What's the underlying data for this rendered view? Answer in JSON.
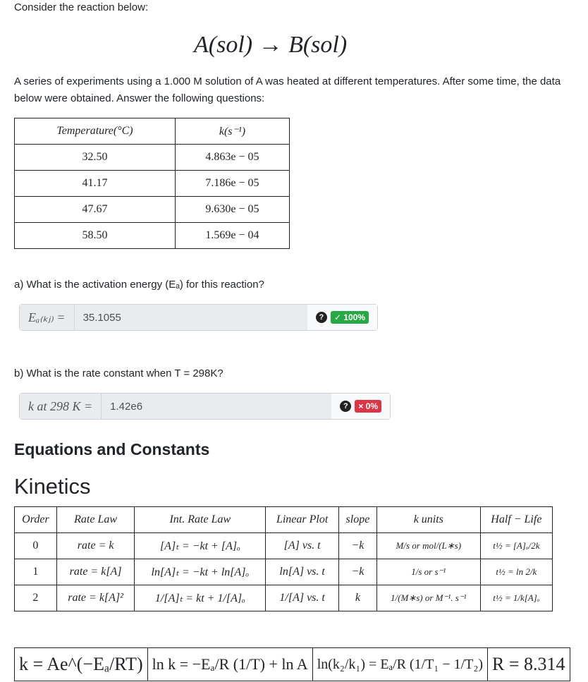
{
  "intro": "Consider the reaction below:",
  "reaction": "A(sol)  →  B(sol)",
  "paragraph": "A series of experiments using a 1.000 M solution of A was heated at different temperatures. After some time, the data below were obtained. Answer the following questions:",
  "data_table": {
    "headers": [
      "Temperature(°C)",
      "k(s⁻¹)"
    ],
    "rows": [
      [
        "32.50",
        "4.863e − 05"
      ],
      [
        "41.17",
        "7.186e − 05"
      ],
      [
        "47.67",
        "9.630e − 05"
      ],
      [
        "58.50",
        "1.569e − 04"
      ]
    ]
  },
  "qa": {
    "question": "a) What is the activation energy (Eₐ) for this reaction?",
    "label": "Eₐ₍ₖⱼ₎ =",
    "value": "35.1055",
    "help": "?",
    "badge": "✓ 100%",
    "badge_color": "#28a745"
  },
  "qb": {
    "question": "b) What is the rate constant when T = 298K?",
    "label": "k at 298 K =",
    "value": "1.42e6",
    "help": "?",
    "badge": "× 0%",
    "badge_color": "#dc3545"
  },
  "section_title": "Equations and Constants",
  "subsection_title": "Kinetics",
  "kinetics_table": {
    "headers": [
      "Order",
      "Rate Law",
      "Int. Rate Law",
      "Linear Plot",
      "slope",
      "k units",
      "Half − Life"
    ],
    "rows": [
      [
        "0",
        "rate = k",
        "[A]ₜ = −kt + [A]ₒ",
        "[A] vs. t",
        "−k",
        "M/s or mol/(L∗s)",
        "t½ = [A]ₒ/2k"
      ],
      [
        "1",
        "rate = k[A]",
        "ln[A]ₜ = −kt + ln[A]ₒ",
        "ln[A] vs. t",
        "−k",
        "1/s or s⁻¹",
        "t½ = ln 2/k"
      ],
      [
        "2",
        "rate = k[A]²",
        "1/[A]ₜ = kt + 1/[A]ₒ",
        "1/[A] vs. t",
        "k",
        "1/(M∗s) or M⁻¹. s⁻¹",
        "t½ = 1/k[A]ₒ"
      ]
    ]
  },
  "equations": [
    "k = Ae^(−Eₐ/RT)",
    "ln k = −Eₐ/R (1/T) + ln A",
    "ln(k₂/k₁) = Eₐ/R (1/T₁ − 1/T₂)",
    "R = 8.314"
  ]
}
